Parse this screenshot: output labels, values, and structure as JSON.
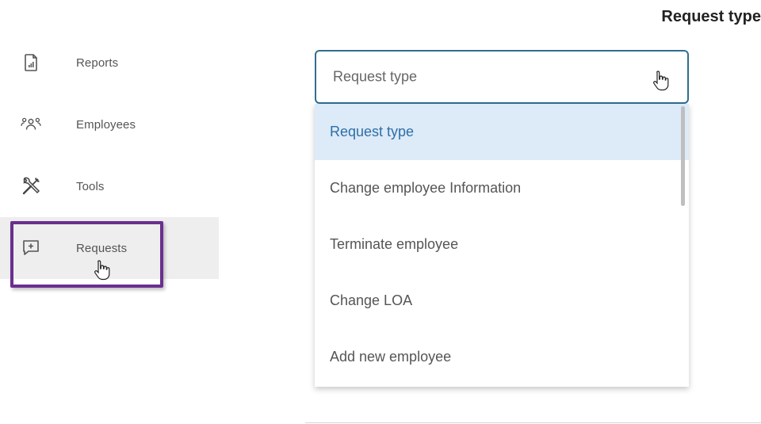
{
  "header": {
    "title": "Request type"
  },
  "sidebar": {
    "items": [
      {
        "label": "Reports",
        "icon": "report-icon"
      },
      {
        "label": "Employees",
        "icon": "employees-icon"
      },
      {
        "label": "Tools",
        "icon": "tools-icon"
      },
      {
        "label": "Requests",
        "icon": "request-add-icon",
        "active": true
      }
    ]
  },
  "request_select": {
    "value": "Request type",
    "options": [
      "Request type",
      "Change employee Information",
      "Terminate employee",
      "Change LOA",
      "Add new employee"
    ],
    "selected_index": 0
  },
  "colors": {
    "accent": "#2f6f8f",
    "selected_bg": "#ddeaf8",
    "selected_text": "#2e6fa7",
    "highlight_border": "#6a2f8f"
  }
}
